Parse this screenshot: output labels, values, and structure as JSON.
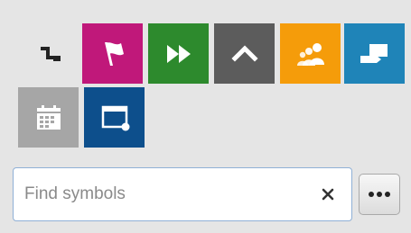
{
  "colors": {
    "background": "#e5e5e5",
    "flag": "#c0187a",
    "fast_forward": "#2d8a2d",
    "caret_up": "#5c5c5c",
    "people": "#f59c0a",
    "sign": "#1f84b8",
    "calendar": "#a6a6a6",
    "window": "#0d4f8c",
    "search_border": "#8fb0d6"
  },
  "symbols": [
    {
      "icon": "connector-icon"
    },
    {
      "icon": "flag-icon"
    },
    {
      "icon": "fast-forward-icon"
    },
    {
      "icon": "caret-up-icon"
    },
    {
      "icon": "people-icon"
    },
    {
      "icon": "signpost-icon"
    },
    {
      "icon": "calendar-icon"
    },
    {
      "icon": "window-dot-icon"
    }
  ],
  "search": {
    "placeholder": "Find symbols",
    "value": "",
    "clear_glyph": "×"
  },
  "more_button": {
    "glyph": "•••"
  }
}
